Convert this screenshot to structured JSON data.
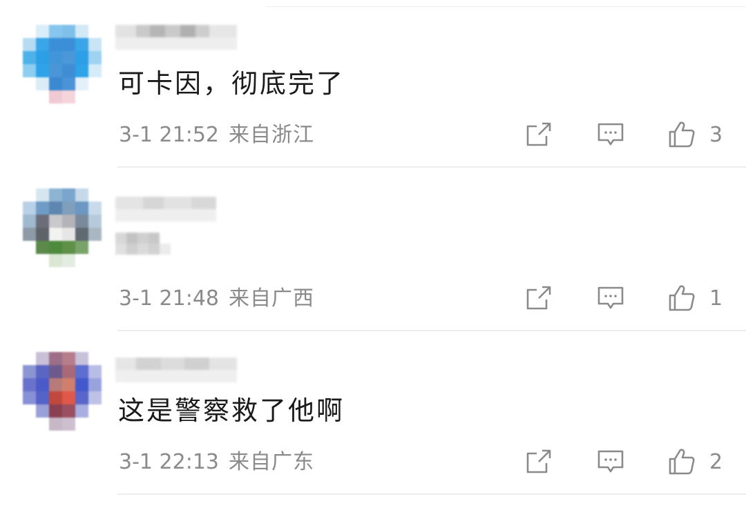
{
  "comments": [
    {
      "username": "",
      "text": "可卡因，彻底完了",
      "time": "3-1 21:52",
      "location": "来自浙江",
      "likes": "3"
    },
    {
      "username": "",
      "text": "",
      "time": "3-1 21:48",
      "location": "来自广西",
      "likes": "1"
    },
    {
      "username": "",
      "text": "这是警察救了他啊",
      "time": "3-1 22:13",
      "location": "来自广东",
      "likes": "2"
    }
  ],
  "icons": {
    "share": "share-icon",
    "reply": "comment-icon",
    "like": "thumbs-up-icon"
  },
  "colors": {
    "text": "#1a1a1a",
    "meta": "#8a8a8a",
    "divider": "#ededed"
  }
}
